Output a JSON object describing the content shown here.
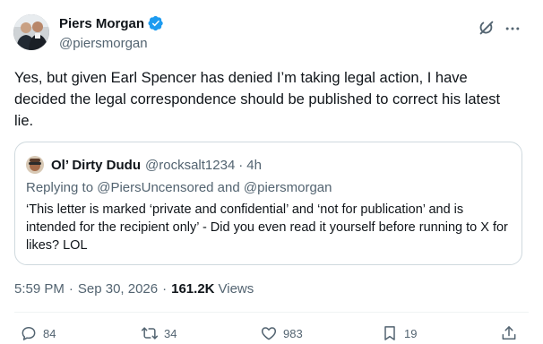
{
  "author": {
    "name": "Piers Morgan",
    "handle": "@piersmorgan"
  },
  "tweet": {
    "text": "Yes, but given Earl Spencer has denied I’m taking legal action, I have decided the legal correspondence should be published to correct his latest lie."
  },
  "quote": {
    "name": "Ol’ Dirty Dudu",
    "handle": "@rocksalt1234",
    "separator": "·",
    "time": "4h",
    "replying_prefix": "Replying to ",
    "replying_mention_1": "@PiersUncensored",
    "replying_and": " and ",
    "replying_mention_2": "@piersmorgan",
    "text": "‘This letter is marked ‘private and confidential’ and ‘not for publication’ and is intended for the recipient only’ - Did you even read it yourself before running to X for likes? LOL"
  },
  "meta": {
    "time": "5:59 PM",
    "date": "Sep 30, 2026",
    "separator": "·",
    "views_count": "161.2K",
    "views_label": "Views"
  },
  "actions": {
    "replies": "84",
    "retweets": "34",
    "likes": "983",
    "bookmarks": "19"
  },
  "colors": {
    "text": "#0f1419",
    "secondary": "#536471",
    "verified": "#1d9bf0",
    "border": "#cfd9de"
  },
  "icons": [
    "verified-badge-icon",
    "grok-icon",
    "more-icon",
    "reply-icon",
    "retweet-icon",
    "like-icon",
    "bookmark-icon",
    "share-icon"
  ]
}
